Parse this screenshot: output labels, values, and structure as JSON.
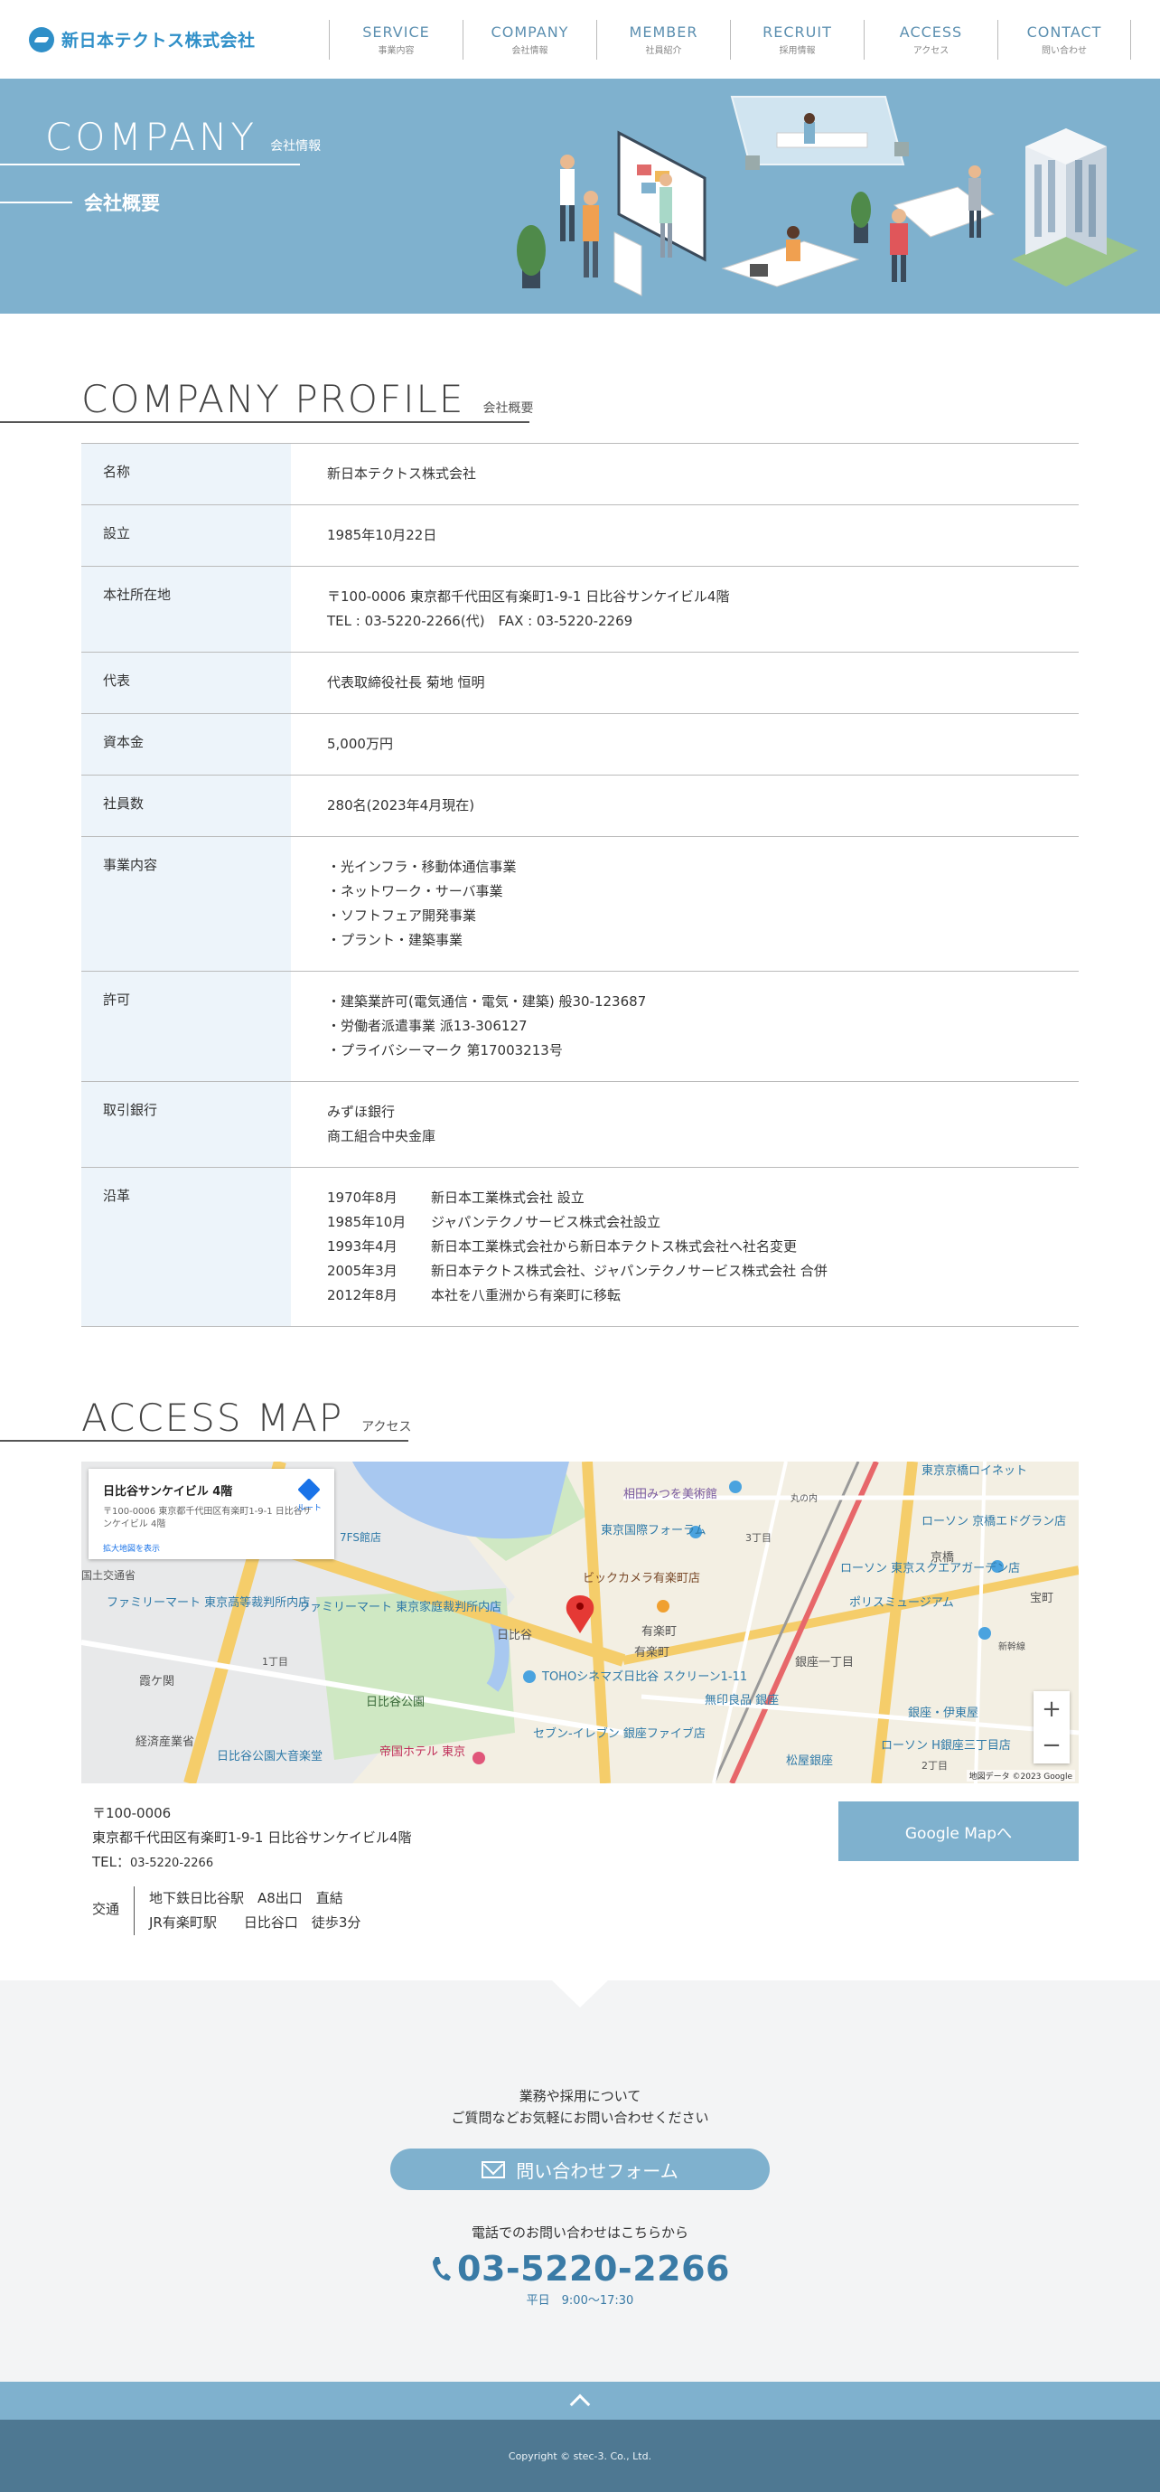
{
  "header": {
    "logo_text": "新日本テクトス株式会社",
    "nav": [
      {
        "en": "SERVICE",
        "jp": "事業内容"
      },
      {
        "en": "COMPANY",
        "jp": "会社情報"
      },
      {
        "en": "MEMBER",
        "jp": "社員紹介"
      },
      {
        "en": "RECRUIT",
        "jp": "採用情報"
      },
      {
        "en": "ACCESS",
        "jp": "アクセス"
      },
      {
        "en": "CONTACT",
        "jp": "問い合わせ"
      }
    ]
  },
  "hero": {
    "title_en": "COMPANY",
    "title_jp": "会社情報",
    "subtitle": "会社概要"
  },
  "profile": {
    "heading_en": "COMPANY PROFILE",
    "heading_jp": "会社概要",
    "rows": [
      {
        "label": "名称",
        "lines": [
          "新日本テクトス株式会社"
        ]
      },
      {
        "label": "設立",
        "lines": [
          "1985年10月22日"
        ]
      },
      {
        "label": "本社所在地",
        "lines": [
          "〒100-0006 東京都千代田区有楽町1-9-1 日比谷サンケイビル4階",
          "TEL : 03-5220-2266(代)　FAX : 03-5220-2269"
        ]
      },
      {
        "label": "代表",
        "lines": [
          "代表取締役社長 菊地 恒明"
        ]
      },
      {
        "label": "資本金",
        "lines": [
          "5,000万円"
        ]
      },
      {
        "label": "社員数",
        "lines": [
          "280名(2023年4月現在)"
        ]
      },
      {
        "label": "事業内容",
        "lines": [
          "・光インフラ・移動体通信事業",
          "・ネットワーク・サーバ事業",
          "・ソフトフェア開発事業",
          "・プラント・建築事業"
        ]
      },
      {
        "label": "許可",
        "lines": [
          "・建築業許可(電気通信・電気・建築) 般30-123687",
          "・労働者派遣事業 派13-306127",
          "・プライバシーマーク 第17003213号"
        ]
      },
      {
        "label": "取引銀行",
        "lines": [
          "みずほ銀行",
          "商工組合中央金庫"
        ]
      }
    ],
    "history": {
      "label": "沿革",
      "items": [
        {
          "date": "1970年8月",
          "text": "新日本工業株式会社 設立"
        },
        {
          "date": "1985年10月",
          "text": "ジャパンテクノサービス株式会社設立"
        },
        {
          "date": "1993年4月",
          "text": "新日本工業株式会社から新日本テクトス株式会社へ社名変更"
        },
        {
          "date": "2005年3月",
          "text": "新日本テクトス株式会社、ジャパンテクノサービス株式会社 合併"
        },
        {
          "date": "2012年8月",
          "text": "本社を八重洲から有楽町に移転"
        }
      ]
    }
  },
  "access": {
    "heading_en": "ACCESS MAP",
    "heading_jp": "アクセス",
    "map": {
      "card_title": "日比谷サンケイビル 4階",
      "card_addr": "〒100-0006 東京都千代田区有楽町1-9-1 日比谷サンケイビル 4階",
      "card_link": "拡大地図を表示",
      "directions": "ルート",
      "copyright": "地図データ ©2023 Google",
      "zoom_in": "+",
      "zoom_out": "−",
      "labels": {
        "aizumitsuo": "相田みつを美術館",
        "forum": "東京国際フォーラム",
        "bic": "ビックカメラ有楽町店",
        "yurakucho": "有楽町",
        "hibiya": "日比谷",
        "toho": "TOHOシネマズ日比谷 スクリーン1-11",
        "hibiya_park": "日比谷公園",
        "imperial": "帝国ホテル 東京",
        "muji": "無印良品 銀座",
        "ginza_itchome": "銀座一丁目",
        "matsuya": "松屋銀座",
        "tokyo_garden": "東京スクエアガーデン",
        "kyobashi": "京橋",
        "police": "ポリスミュージアム",
        "famima1": "ファミリーマート 東京高等裁判所内店",
        "famima2": "ファミリーマート 東京家庭裁判所内店",
        "kasumigaseki": "霞ケ関",
        "seven": "セブン-イレブン 銀座ファイブ店",
        "ginza_itoya": "銀座・伊東屋",
        "lawson1": "ローソン 京橋エドグラン店",
        "lawson2": "ローソン 東京スクエアガーデン店",
        "hotel": "東京京橋ロイネット",
        "maru": "丸の内",
        "shinkansen": "新幹線",
        "takaracho": "宝町",
        "park_hall": "日比谷公園大音楽堂",
        "lawson3": "ローソン H銀座三丁目店",
        "keizai": "経済産業省",
        "chome1": "1丁目",
        "chome3": "3丁目",
        "chome2": "2丁目",
        "yurakucho_st": "有楽町",
        "kokudo": "国土交通省",
        "tfs": "7FS館店"
      }
    },
    "address_lines": [
      "〒100-0006",
      "東京都千代田区有楽町1-9-1 日比谷サンケイビル4階"
    ],
    "tel_label": "TEL：",
    "tel": "03-5220-2266",
    "transit_label": "交通",
    "transit": [
      "地下鉄日比谷駅　A8出口　直結",
      "JR有楽町駅　　日比谷口　徒歩3分"
    ],
    "gmap_button": "Google Mapへ"
  },
  "contact": {
    "message_lines": [
      "業務や採用について",
      "ご質問などお気軽にお問い合わせください"
    ],
    "form_button": "問い合わせフォーム",
    "phone_note": "電話でのお問い合わせはこちらから",
    "phone": "03-5220-2266",
    "hours": "平日　9:00〜17:30"
  },
  "footer": {
    "copyright": "Copyright © stec-3. Co., Ltd."
  },
  "colors": {
    "brand_blue": "#2f8fc8",
    "accent_light": "#7fb1ce",
    "footer": "#4e7892"
  }
}
